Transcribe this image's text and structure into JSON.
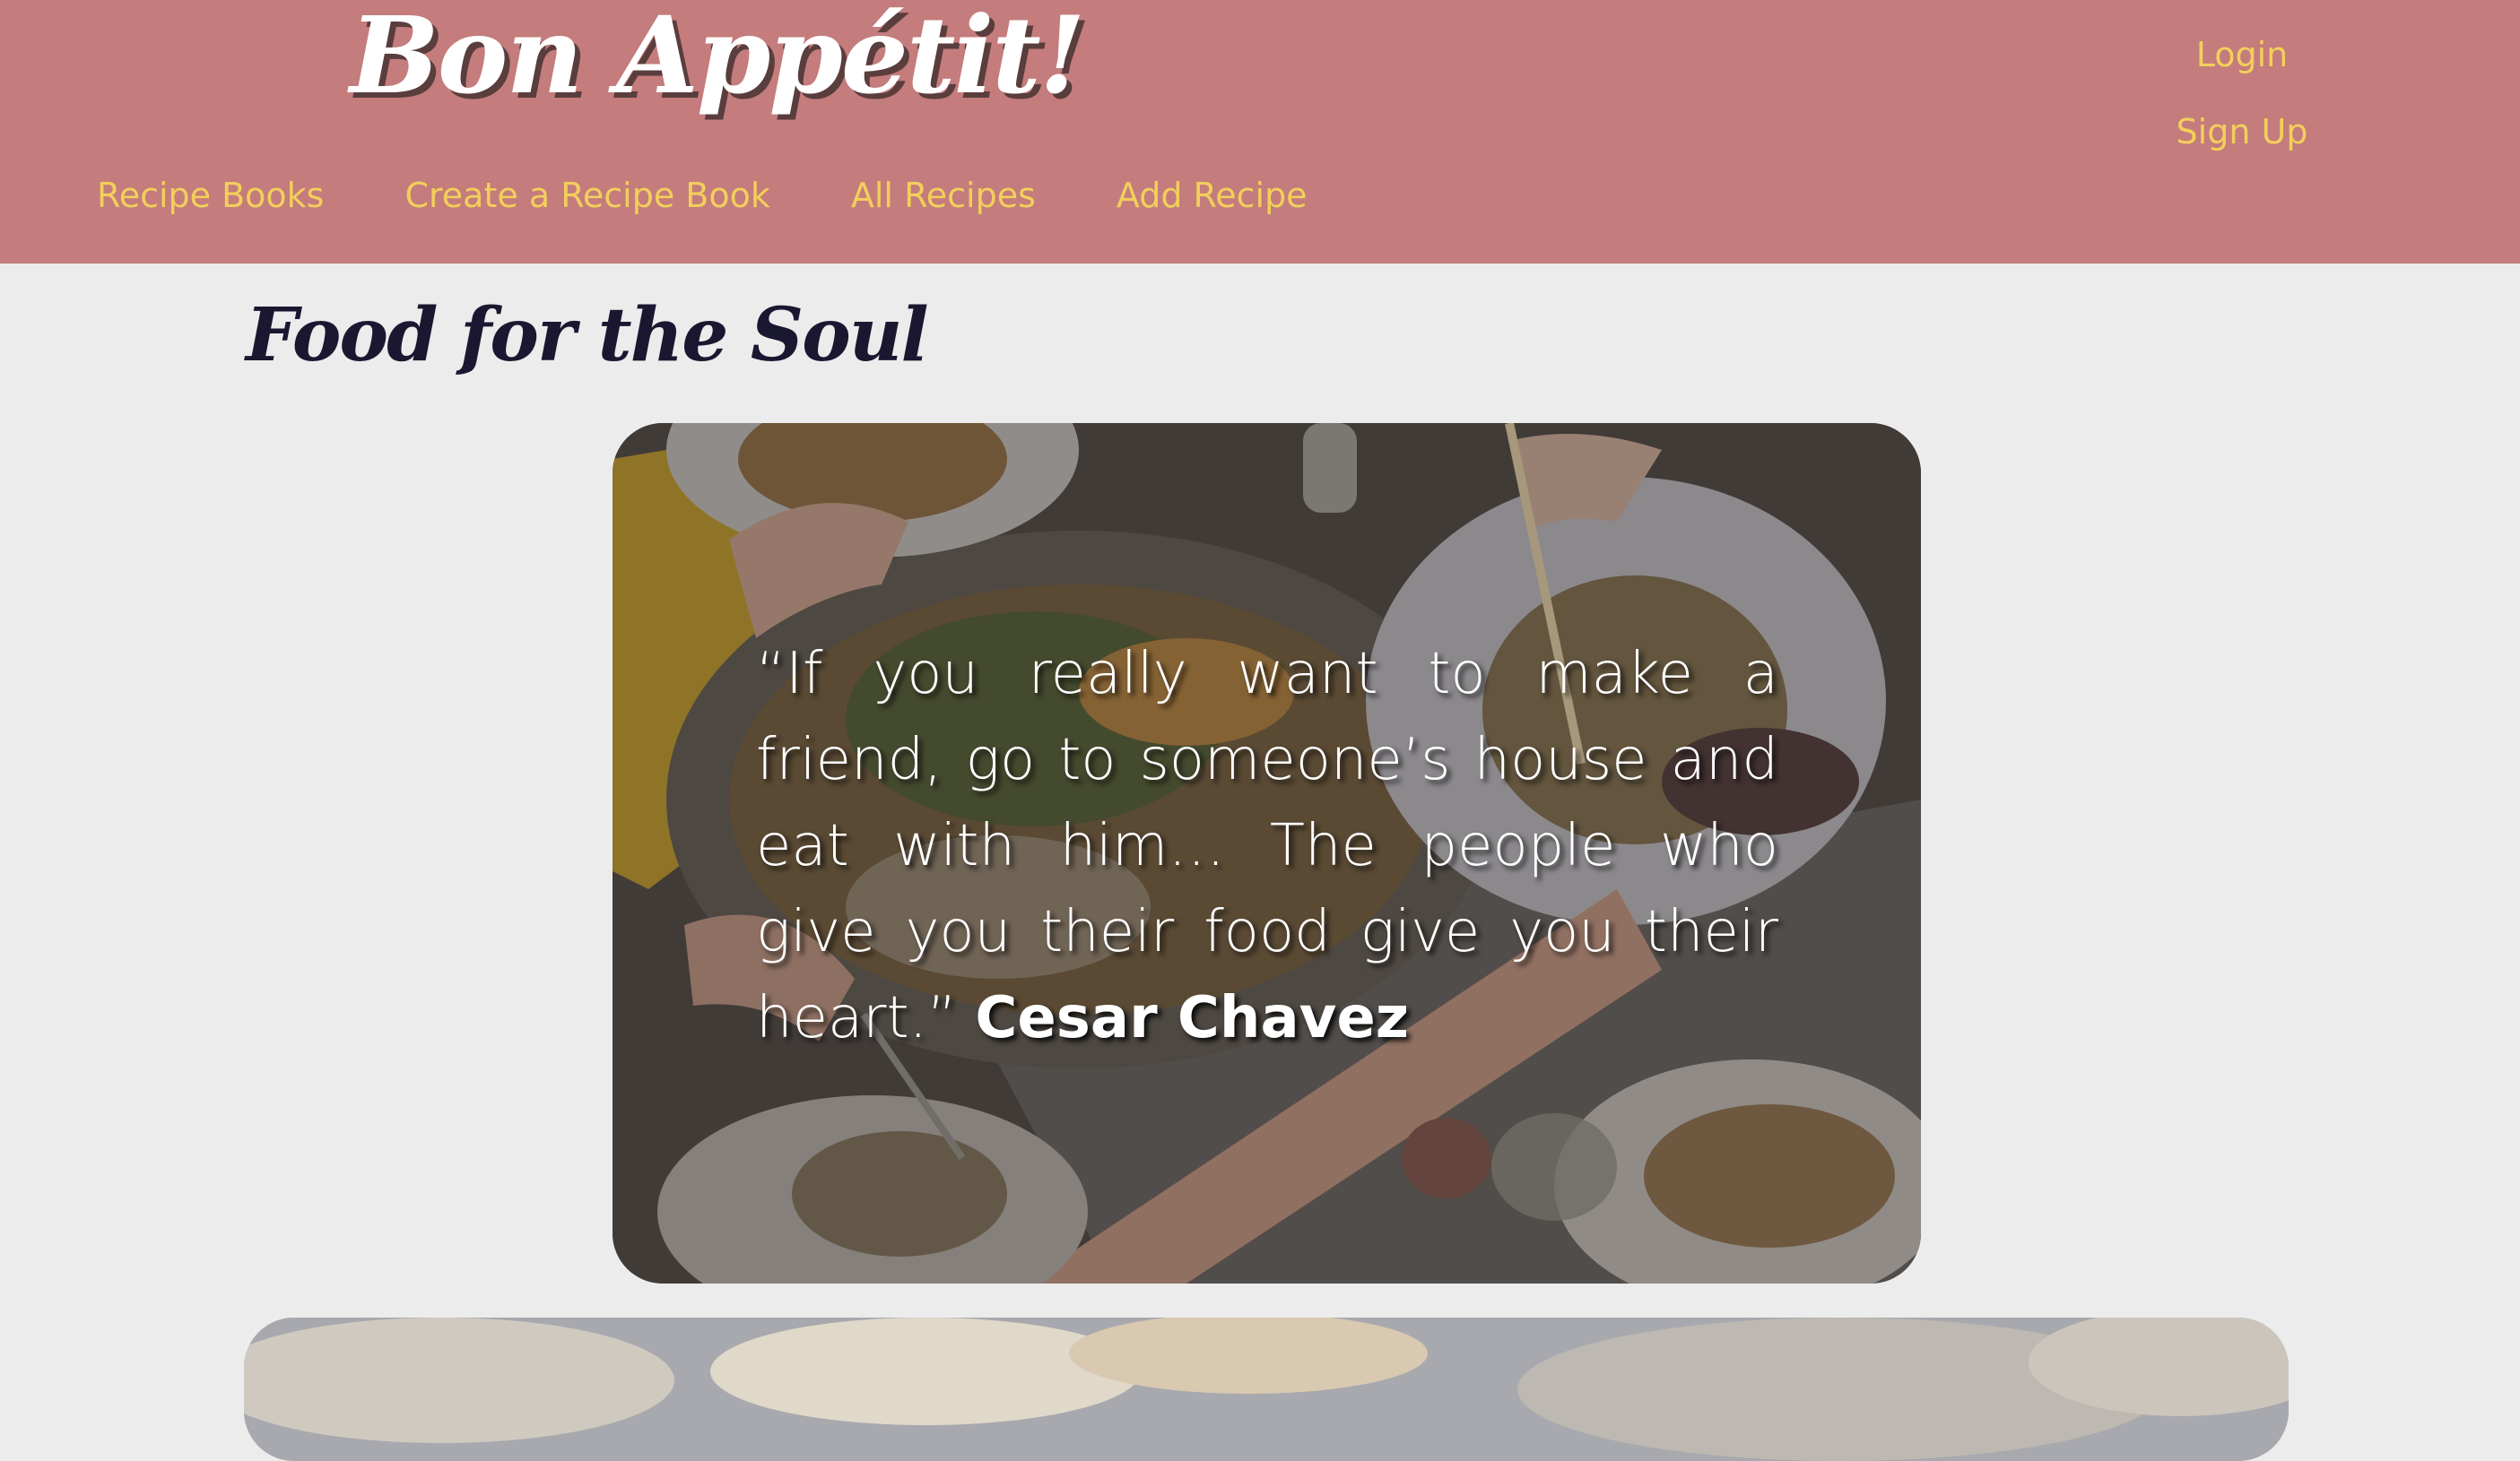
{
  "header": {
    "brand": "Bon Appétit!",
    "auth": {
      "login": "Login",
      "signup": "Sign Up"
    },
    "nav": [
      {
        "label": "Recipe Books"
      },
      {
        "label": "Create a Recipe Book"
      },
      {
        "label": "All Recipes"
      },
      {
        "label": "Add Recipe"
      }
    ],
    "colors": {
      "header_bg": "#c47c7c",
      "link": "#f2cf5b",
      "brand_text": "#ffffff"
    }
  },
  "main": {
    "title": "Food for the Soul",
    "hero": {
      "quote": "“If you really want to make a friend, go to someone’s house and eat with him… The people who give you their food give you their heart.”",
      "author": "Cesar Chavez",
      "image": "shared-meal-table-photo"
    },
    "second_card": {
      "image": "sky-clouds-photo"
    },
    "colors": {
      "page_bg": "#ececec",
      "title": "#1a1730"
    }
  }
}
